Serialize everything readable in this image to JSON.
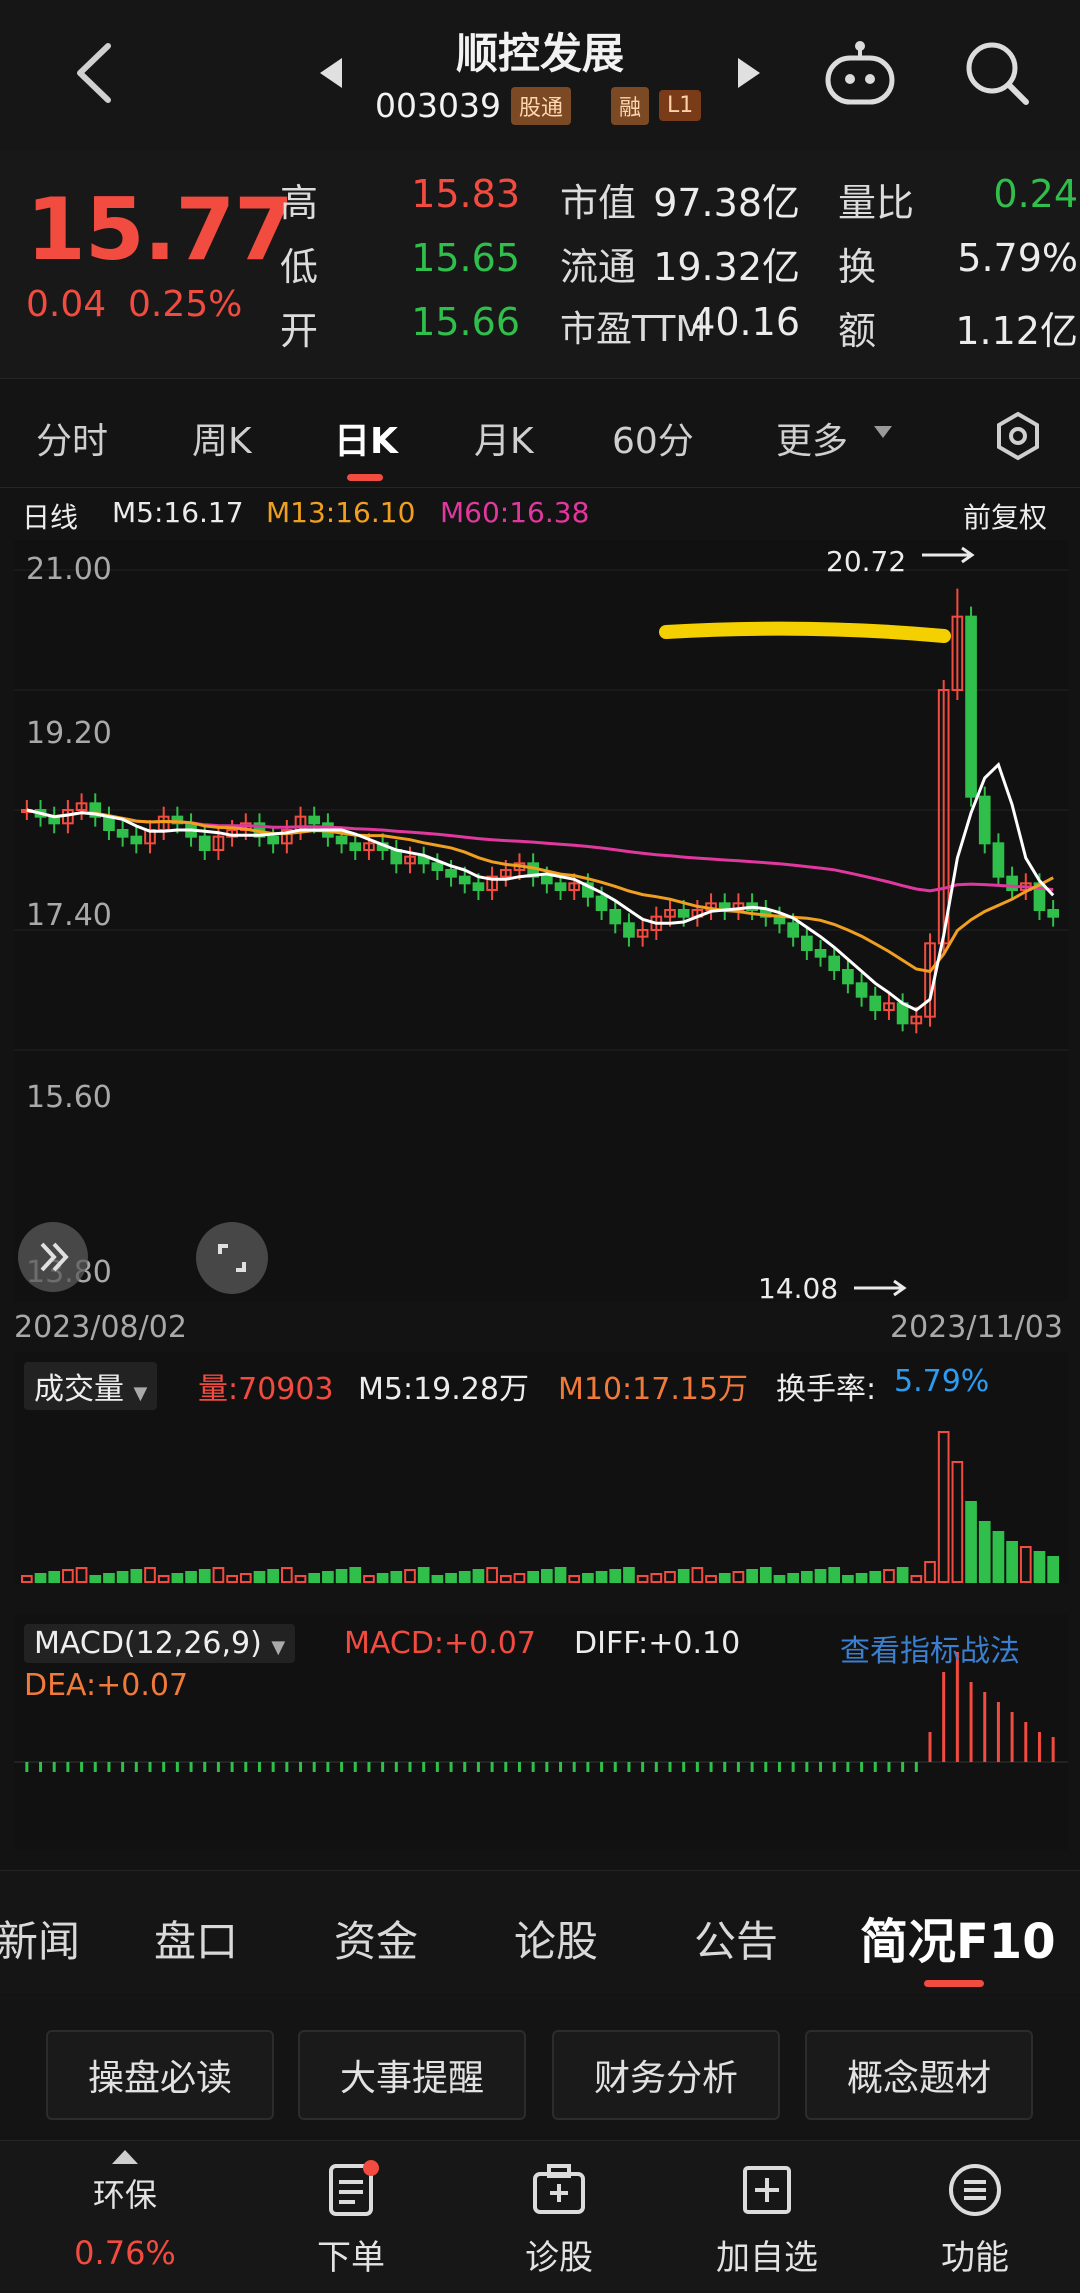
{
  "header": {
    "title": "顺控发展",
    "code": "003039",
    "tag_hsgt": "股通",
    "tag_rong": "融",
    "tag_level": "L1"
  },
  "quote": {
    "price": "15.77",
    "change": "0.04",
    "change_pct": "0.25%",
    "high_label": "高",
    "high": "15.83",
    "low_label": "低",
    "low": "15.65",
    "open_label": "开",
    "open": "15.66",
    "mcap_label": "市值",
    "mcap": "97.38亿",
    "float_label": "流通",
    "float": "19.32亿",
    "pe_label": "市盈TTM",
    "pe": "40.16",
    "vr_label": "量比",
    "vr": "0.24",
    "turnover_label": "换",
    "turnover": "5.79%",
    "amount_label": "额",
    "amount": "1.12亿"
  },
  "tabs": [
    "分时",
    "周K",
    "日K",
    "月K",
    "60分",
    "更多"
  ],
  "kline": {
    "period": "日线",
    "ma5": "M5:16.17",
    "ma13": "M13:16.10",
    "ma60": "M60:16.38",
    "adjust": "前复权",
    "y_labels": [
      "21.00",
      "19.20",
      "17.40",
      "15.60",
      "13.80"
    ],
    "high_mark": "20.72",
    "low_mark": "14.08",
    "date_start": "2023/08/02",
    "date_end": "2023/11/03",
    "colors": {
      "up": "#f24b3f",
      "down": "#2fbf4a",
      "ma5": "#ffffff",
      "ma13": "#f0a020",
      "ma60": "#e0389f",
      "highlight": "#f5d000"
    }
  },
  "volume": {
    "selector": "成交量",
    "vol": "量:70903",
    "m5": "M5:19.28万",
    "m10": "M10:17.15万",
    "turnover_label": "换手率:",
    "turnover": "5.79%"
  },
  "macd": {
    "selector": "MACD(12,26,9)",
    "macd": "MACD:+0.07",
    "diff": "DIFF:+0.10",
    "dea": "DEA:+0.07",
    "link": "查看指标战法"
  },
  "bottom_tabs": [
    "新闻",
    "盘口",
    "资金",
    "论股",
    "公告",
    "简况F10"
  ],
  "f10_buttons": [
    "操盘必读",
    "大事提醒",
    "财务分析",
    "概念题材"
  ],
  "nav": {
    "sector": "环保",
    "sector_pct": "0.76%",
    "items": [
      "下单",
      "诊股",
      "加自选",
      "功能"
    ]
  }
}
